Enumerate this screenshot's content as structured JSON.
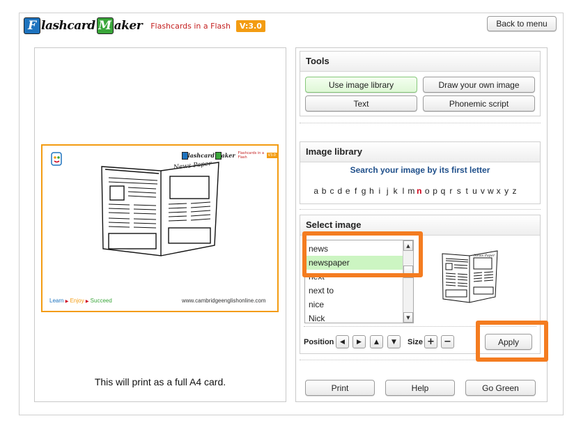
{
  "header": {
    "logo_letter1": "F",
    "logo_word1": "lashcard",
    "logo_letter2": "M",
    "logo_word2": "aker",
    "tagline": "Flashcards in a Flash",
    "version": "V:3.0",
    "back_button": "Back to menu"
  },
  "preview": {
    "card_logo_word1": "lashcard",
    "card_logo_word2": "aker",
    "card_tagline": "Flashcards in a Flash",
    "card_version": "V3.0",
    "image_caption": "News Paper",
    "footer_left": [
      "Learn",
      "Enjoy",
      "Succeed"
    ],
    "footer_right": "www.cambridgeenglishonline.com",
    "print_note": "This will print as a full A4 card."
  },
  "tools": {
    "title": "Tools",
    "buttons": [
      "Use image library",
      "Draw your own image",
      "Text",
      "Phonemic script"
    ]
  },
  "library": {
    "title": "Image library",
    "caption": "Search your image by its first letter",
    "letters": [
      "a",
      "b",
      "c",
      "d",
      "e",
      "f",
      "g",
      "h",
      "i",
      "j",
      "k",
      "l",
      "m",
      "n",
      "o",
      "p",
      "q",
      "r",
      "s",
      "t",
      "u",
      "v",
      "w",
      "x",
      "y",
      "z"
    ],
    "selected_letter": "n"
  },
  "select_image": {
    "title": "Select image",
    "items": [
      "news",
      "newspaper",
      "next",
      "next to",
      "nice",
      "Nick"
    ],
    "selected": "newspaper",
    "position_label": "Position",
    "size_label": "Size",
    "apply": "Apply"
  },
  "bottom_buttons": [
    "Print",
    "Help",
    "Go Green"
  ],
  "colors": {
    "accent_orange": "#f47c20",
    "logo_blue": "#1e73be",
    "logo_green": "#3aa63a",
    "selected_row": "#ccf5c2",
    "selected_letter": "#d0021b"
  }
}
